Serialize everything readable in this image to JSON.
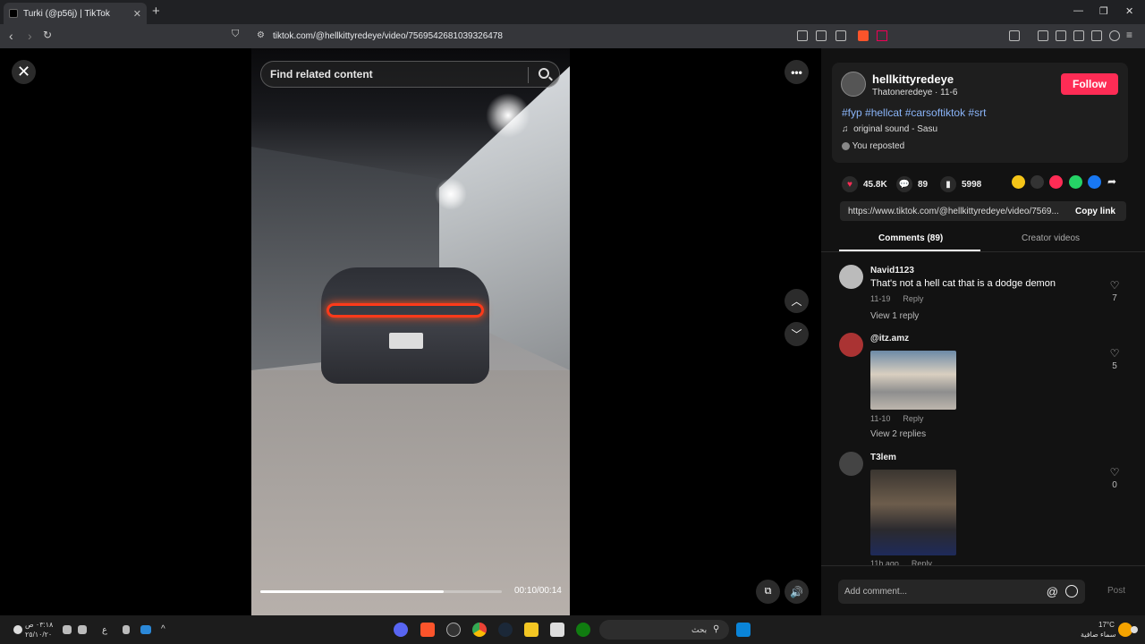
{
  "browser": {
    "tab_title": "Turki (@p56j) | TikTok",
    "url": "tiktok.com/@hellkittyredeye/video/7569542681039326478"
  },
  "video": {
    "search_placeholder": "Find related content",
    "time": "00:10/00:14",
    "progress": 0.76
  },
  "post": {
    "username": "hellkittyredeye",
    "nickname_date": "Thatoneredeye · 11-6",
    "follow_label": "Follow",
    "hashtags": "#fyp #hellcat #carsoftiktok #srt",
    "sound": "original sound - Sasu",
    "repost": "You reposted",
    "likes": "45.8K",
    "comments_count": "89",
    "saves": "5998",
    "link": "https://www.tiktok.com/@hellkittyredeye/video/7569...",
    "copy_link": "Copy link"
  },
  "tabs": {
    "comments": "Comments (89)",
    "creator": "Creator videos"
  },
  "comments": [
    {
      "name": "Navid1123",
      "text": "That's not a hell cat that is a dodge demon",
      "date": "11-19",
      "reply": "Reply",
      "view_replies": "View 1 reply",
      "likes": "7"
    },
    {
      "name": "@itz.amz",
      "text": "",
      "date": "11-10",
      "reply": "Reply",
      "view_replies": "View 2 replies",
      "likes": "5"
    },
    {
      "name": "T3lem",
      "text": "",
      "date": "11h ago",
      "reply": "Reply",
      "view_replies": "",
      "likes": "0"
    }
  ],
  "comment_bar": {
    "placeholder": "Add comment...",
    "post_label": "Post"
  },
  "taskbar": {
    "time": "٠٣:١٨ ص",
    "date": "٢٥/١٠/٢٠",
    "lang": "ع",
    "search": "بحث",
    "weather_temp": "17°C",
    "weather_desc": "سماء صافية"
  },
  "colors": {
    "follow": "#fe2c55",
    "hashtag": "#8ab4f8",
    "like": "#fe2c55"
  }
}
